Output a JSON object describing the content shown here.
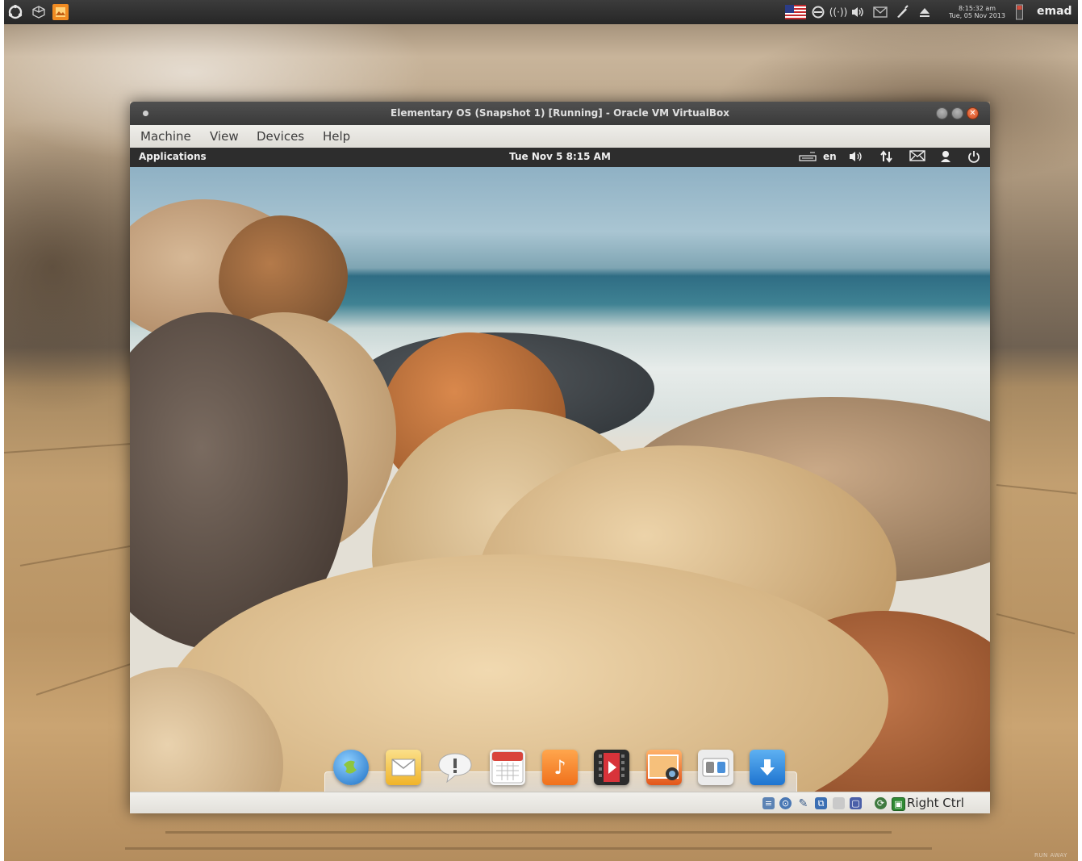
{
  "host_panel": {
    "left_icons": [
      "ubuntu-logo-icon",
      "cube-icon",
      "image-viewer-icon"
    ],
    "indicator_icons": [
      "us-flag-icon",
      "sync-icon",
      "wireless-icon",
      "volume-icon",
      "mail-icon",
      "pen-icon",
      "eject-icon"
    ],
    "clock_time": "8:15:32 am",
    "clock_date": "Tue, 05 Nov 2013",
    "user": "emad"
  },
  "watermark": "RUN AWAY",
  "window": {
    "title": "Elementary OS (Snapshot 1) [Running] - Oracle VM VirtualBox",
    "menu": [
      "Machine",
      "View",
      "Devices",
      "Help"
    ]
  },
  "guest_panel": {
    "applications": "Applications",
    "clock": "Tue Nov  5  8:15 AM",
    "keyboard_layout": "en",
    "indicators": [
      "keyboard-icon",
      "volume-icon",
      "network-icon",
      "mail-icon",
      "user-icon",
      "power-icon"
    ]
  },
  "dock": {
    "items": [
      "web-browser-icon",
      "mail-icon",
      "notifications-icon",
      "calendar-icon",
      "music-icon",
      "video-icon",
      "photos-icon",
      "system-settings-icon",
      "software-center-icon"
    ]
  },
  "statusbar": {
    "icons": [
      "hard-disk-icon",
      "optical-drive-icon",
      "usb-icon",
      "network-adapter-icon",
      "shared-folder-icon",
      "video-capture-icon",
      "cpu-icon",
      "mouse-integration-icon"
    ],
    "host_key": "Right Ctrl"
  },
  "colors": {
    "panel_dark": "#2d2d2d",
    "close_button": "#e0572f",
    "menubar": "#e8e6e1"
  }
}
